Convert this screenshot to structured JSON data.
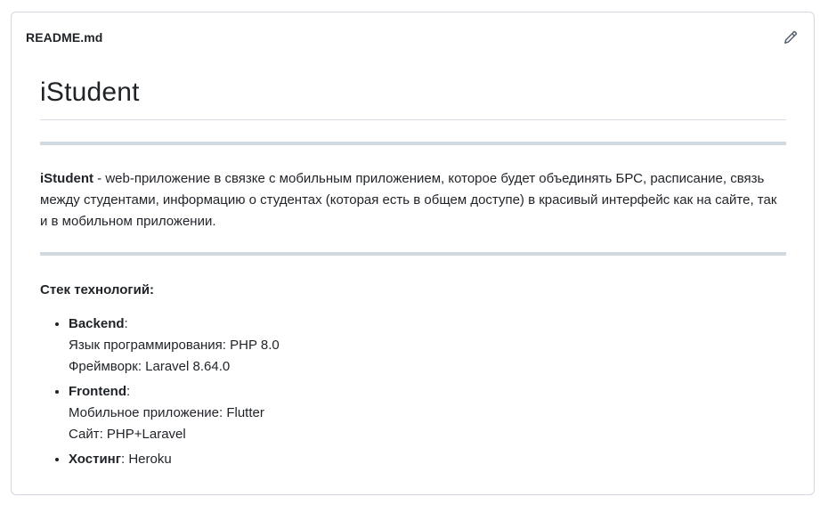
{
  "header": {
    "filename": "README.md",
    "edit_icon": "pencil-icon"
  },
  "readme": {
    "title": "iStudent",
    "intro_bold": "iStudent",
    "intro_rest": " - web-приложение в связке с мобильным приложением, которое будет объединять БРС, расписание, связь между студентами, информацию о студентах (которая есть в общем доступе) в красивый интерфейс как на сайте, так и в мобильном приложении.",
    "stack_title": "Стек технологий:",
    "stack": [
      {
        "name": "Backend",
        "suffix": ":",
        "lines": [
          "Язык программирования: PHP 8.0",
          "Фреймворк: Laravel 8.64.0"
        ]
      },
      {
        "name": "Frontend",
        "suffix": ":",
        "lines": [
          "Мобильное приложение: Flutter",
          "Сайт: PHP+Laravel"
        ]
      },
      {
        "name": "Хостинг",
        "suffix": ": Heroku",
        "lines": []
      }
    ]
  },
  "colors": {
    "border": "#d0d7de",
    "text": "#1f2328",
    "hr": "#d1d9e0"
  }
}
